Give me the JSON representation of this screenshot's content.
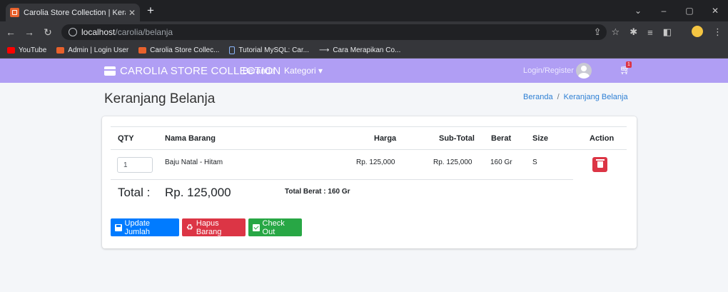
{
  "browser": {
    "tab_title": "Carolia Store Collection | Keranja...",
    "tab_close": "✕",
    "new_tab": "+",
    "url_host": "localhost",
    "url_path": "/carolia/belanja",
    "bookmarks": [
      {
        "label": "YouTube",
        "icon": "youtube-icon"
      },
      {
        "label": "Admin | Login User",
        "icon": "carolia-favicon"
      },
      {
        "label": "Carolia Store Collec...",
        "icon": "carolia-favicon"
      },
      {
        "label": "Tutorial MySQL: Car...",
        "icon": "page-icon"
      },
      {
        "label": "Cara Merapikan Co...",
        "icon": "arrow-icon"
      }
    ]
  },
  "navbar": {
    "brand": "CAROLIA STORE COLLECTION",
    "beranda": "Beranda",
    "kategori": "Kategori ▾",
    "login": "Login/Register",
    "cart_count": "1",
    "bg_color": "#b09ef4"
  },
  "page": {
    "title": "Keranjang Belanja",
    "breadcrumb": {
      "home": "Beranda",
      "sep": "/",
      "current": "Keranjang Belanja"
    }
  },
  "cart": {
    "headers": {
      "qty": "QTY",
      "nama": "Nama Barang",
      "harga": "Harga",
      "subtotal": "Sub-Total",
      "berat": "Berat",
      "size": "Size",
      "action": "Action"
    },
    "rows": [
      {
        "qty": "1",
        "nama": "Baju Natal - Hitam",
        "harga": "Rp. 125,000",
        "subtotal": "Rp. 125,000",
        "berat": "160 Gr",
        "size": "S"
      }
    ],
    "total_label": "Total :",
    "total_value": "Rp. 125,000",
    "total_berat": "Total Berat : 160 Gr",
    "buttons": {
      "update": "Update Jumlah",
      "hapus": "Hapus Barang",
      "checkout": "Check Out"
    }
  }
}
